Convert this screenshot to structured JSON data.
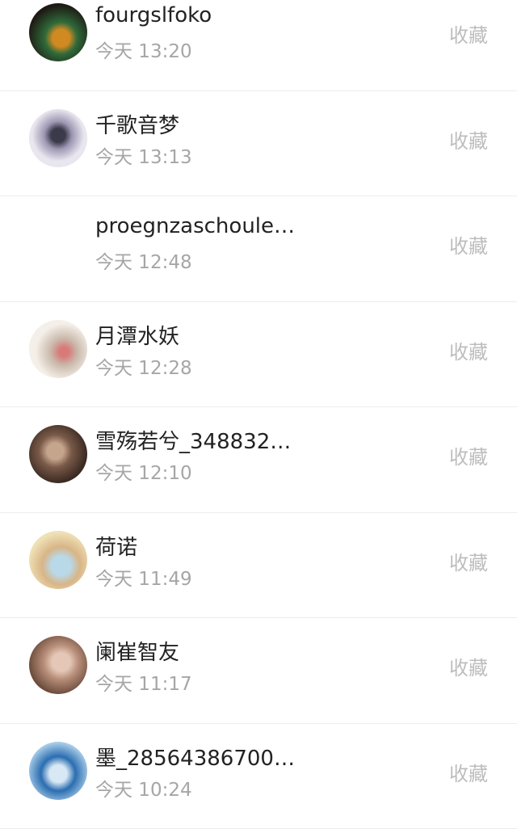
{
  "messages": [
    {
      "name": "fourgslfoko",
      "time": "今天 13:20",
      "action": "收藏",
      "avatar": {
        "icon": "avatar-image",
        "colors": [
          "#d18a22",
          "#1e1a14",
          "#2f6a3a"
        ]
      }
    },
    {
      "name": "千歌音梦",
      "time": "今天 13:13",
      "action": "收藏",
      "avatar": {
        "icon": "avatar-image",
        "colors": [
          "#e8e6ee",
          "#3b3a4a",
          "#9d97b3"
        ]
      }
    },
    {
      "name": "proegnzaschoule…",
      "time": "今天 12:48",
      "action": "收藏",
      "avatar": {
        "icon": "none",
        "colors": []
      }
    },
    {
      "name": "月潭水妖",
      "time": "今天 12:28",
      "action": "收藏",
      "avatar": {
        "icon": "avatar-image",
        "colors": [
          "#f4efe8",
          "#c9b8aa",
          "#d97a7a"
        ]
      }
    },
    {
      "name": "雪殇若兮_348832…",
      "time": "今天 12:10",
      "action": "收藏",
      "avatar": {
        "icon": "avatar-image",
        "colors": [
          "#3a2a22",
          "#c5a58c",
          "#7a5a48"
        ]
      }
    },
    {
      "name": "荷诺",
      "time": "今天 11:49",
      "action": "收藏",
      "avatar": {
        "icon": "avatar-image",
        "colors": [
          "#efe1b6",
          "#b9d9e9",
          "#d8b587"
        ]
      }
    },
    {
      "name": "阑崔智友",
      "time": "今天 11:17",
      "action": "收藏",
      "avatar": {
        "icon": "avatar-image",
        "colors": [
          "#6b4a3a",
          "#e4c7b7",
          "#b88f7a"
        ]
      }
    },
    {
      "name": "墨_28564386700…",
      "time": "今天 10:24",
      "action": "收藏",
      "avatar": {
        "icon": "avatar-image",
        "colors": [
          "#a9cde9",
          "#2b6db0",
          "#d8e8f4"
        ]
      }
    }
  ]
}
